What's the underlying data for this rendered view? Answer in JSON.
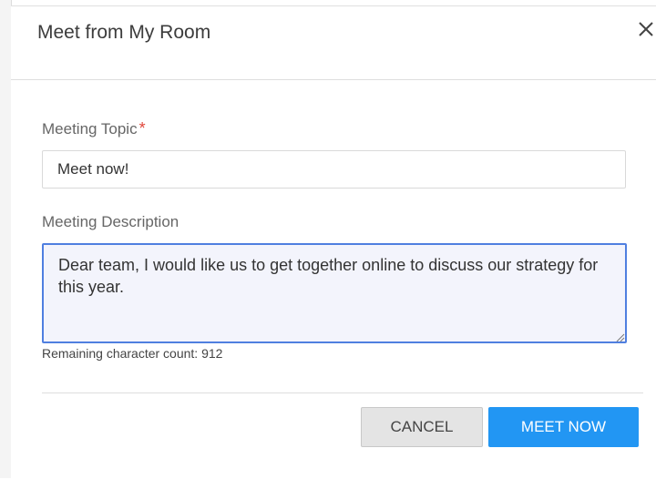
{
  "dialog": {
    "title": "Meet from My Room",
    "close_icon": "close-icon"
  },
  "form": {
    "topic_label": "Meeting Topic",
    "required_marker": "*",
    "topic_value": "Meet now!",
    "description_label": "Meeting Description",
    "description_value": "Dear team, I would like us to get together online to discuss our strategy for this year.",
    "remaining_count": "Remaining character count: 912"
  },
  "actions": {
    "cancel_label": "CANCEL",
    "meet_label": "MEET NOW"
  },
  "colors": {
    "primary": "#2296f3",
    "required": "#e0463a",
    "focus_border": "#4f7fe0"
  }
}
